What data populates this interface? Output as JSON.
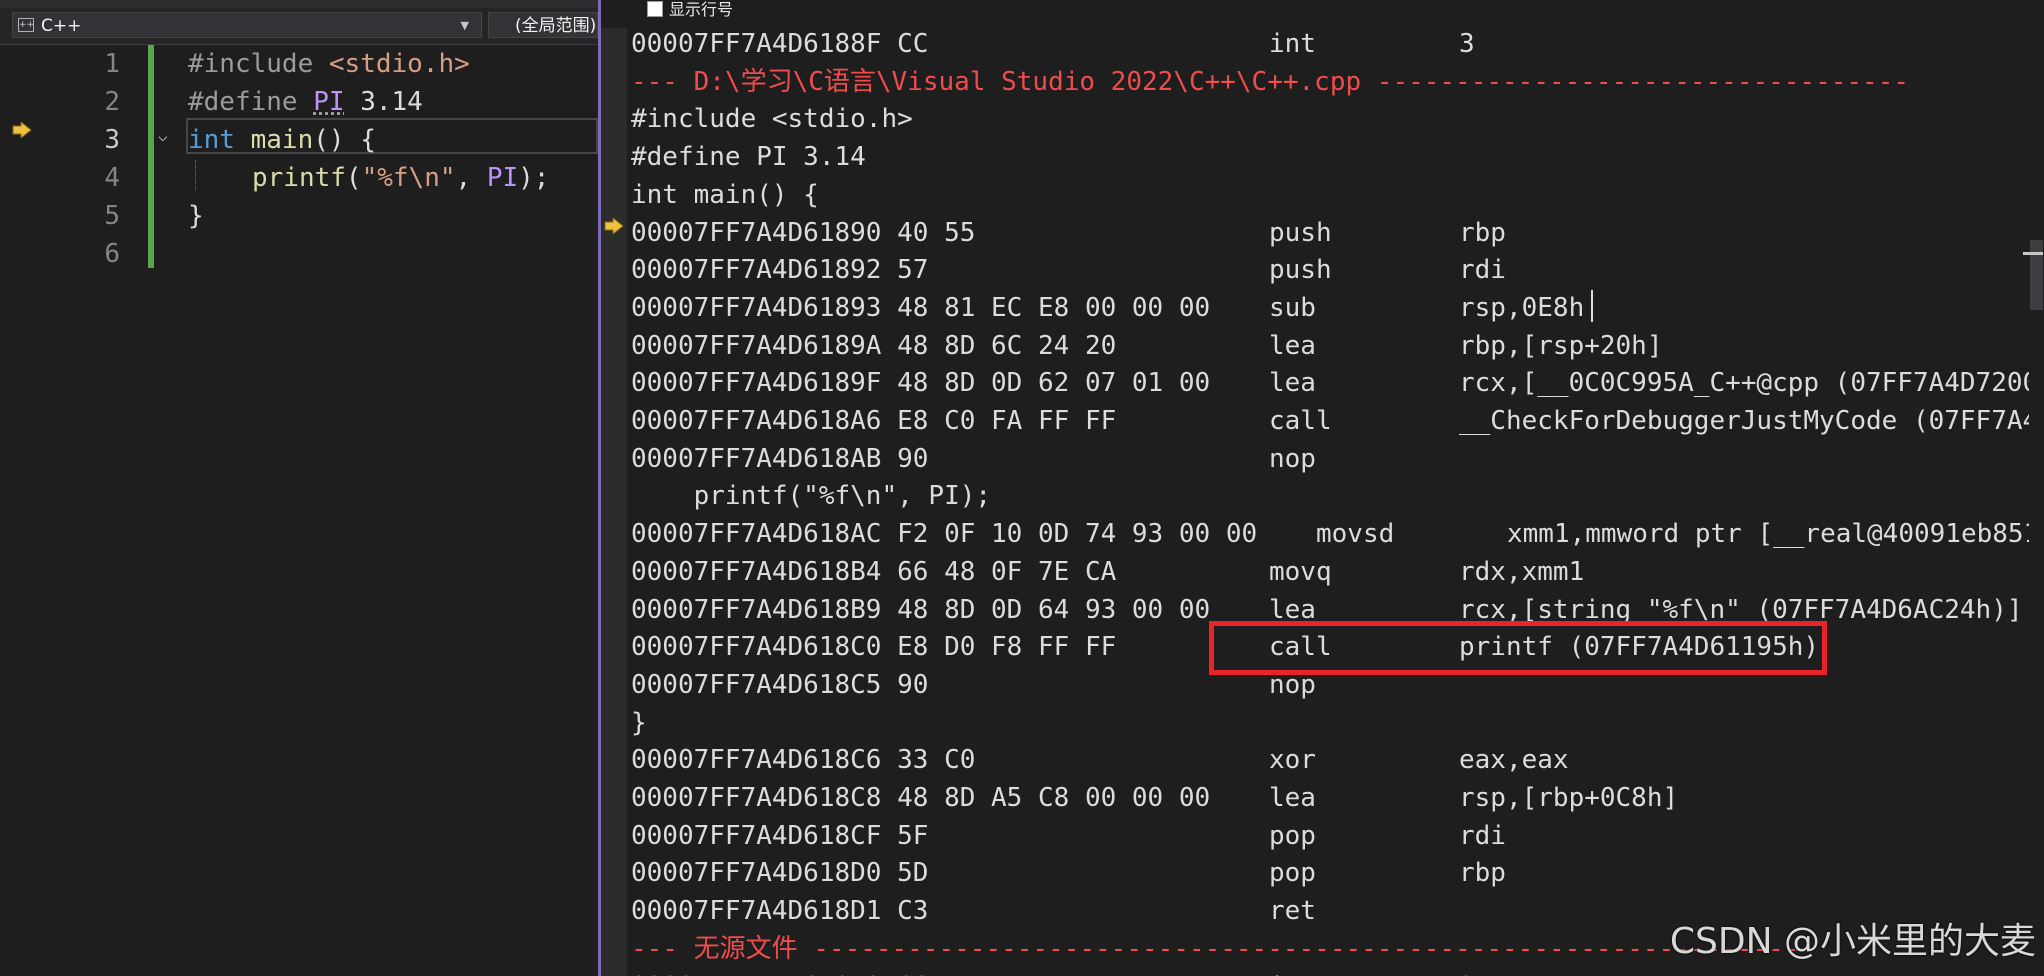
{
  "editor": {
    "project_combo": "C++",
    "scope_combo": "(全局范围)",
    "lines": [
      {
        "num": "1"
      },
      {
        "num": "2"
      },
      {
        "num": "3"
      },
      {
        "num": "4"
      },
      {
        "num": "5"
      },
      {
        "num": "6"
      }
    ],
    "code": {
      "l1_directive": "#include ",
      "l1_header": "<stdio.h>",
      "l2_directive": "#define ",
      "l2_macro": "PI",
      "l2_value": " 3.14",
      "l3_kw": "int",
      "l3_fn": " main",
      "l3_rest": "() {",
      "l4_fn": "printf",
      "l4_open": "(",
      "l4_str": "\"%f\\n\"",
      "l4_comma": ", ",
      "l4_macro": "PI",
      "l4_close": ");",
      "l5": "}"
    }
  },
  "disassembly": {
    "show_line_numbers_label": "显示行号",
    "rows": [
      {
        "kind": "asm",
        "addr": "00007FF7A4D6188F CC",
        "mn": "int",
        "op": "3"
      },
      {
        "kind": "header",
        "text": "--- D:\\学习\\C语言\\Visual Studio 2022\\C++\\C++.cpp ----------------------------------"
      },
      {
        "kind": "src",
        "text": "#include <stdio.h>"
      },
      {
        "kind": "src",
        "text": "#define PI 3.14"
      },
      {
        "kind": "src",
        "text": "int main() {"
      },
      {
        "kind": "asm",
        "addr": "00007FF7A4D61890 40 55",
        "mn": "push",
        "op": "rbp"
      },
      {
        "kind": "asm",
        "addr": "00007FF7A4D61892 57",
        "mn": "push",
        "op": "rdi"
      },
      {
        "kind": "asm",
        "addr": "00007FF7A4D61893 48 81 EC E8 00 00 00",
        "mn": "sub",
        "op": "rsp,0E8h"
      },
      {
        "kind": "asm",
        "addr": "00007FF7A4D6189A 48 8D 6C 24 20",
        "mn": "lea",
        "op": "rbp,[rsp+20h]"
      },
      {
        "kind": "asm",
        "addr": "00007FF7A4D6189F 48 8D 0D 62 07 01 00",
        "mn": "lea",
        "op": "rcx,[__0C0C995A_C++@cpp (07FF7A4D7200"
      },
      {
        "kind": "asm",
        "addr": "00007FF7A4D618A6 E8 C0 FA FF FF",
        "mn": "call",
        "op": "__CheckForDebuggerJustMyCode (07FF7A4"
      },
      {
        "kind": "asm",
        "addr": "00007FF7A4D618AB 90",
        "mn": "nop",
        "op": ""
      },
      {
        "kind": "src",
        "text": "    printf(\"%f\\n\", PI);"
      },
      {
        "kind": "asm_wide",
        "addr": "00007FF7A4D618AC F2 0F 10 0D 74 93 00 00",
        "mn": "movsd",
        "op": "xmm1,mmword ptr [__real@40091eb851"
      },
      {
        "kind": "asm",
        "addr": "00007FF7A4D618B4 66 48 0F 7E CA",
        "mn": "movq",
        "op": "rdx,xmm1"
      },
      {
        "kind": "asm",
        "addr": "00007FF7A4D618B9 48 8D 0D 64 93 00 00",
        "mn": "lea",
        "op": "rcx,[string \"%f\\n\" (07FF7A4D6AC24h)]"
      },
      {
        "kind": "asm",
        "addr": "00007FF7A4D618C0 E8 D0 F8 FF FF",
        "mn": "call",
        "op": "printf (07FF7A4D61195h)"
      },
      {
        "kind": "asm",
        "addr": "00007FF7A4D618C5 90",
        "mn": "nop",
        "op": ""
      },
      {
        "kind": "src",
        "text": "}"
      },
      {
        "kind": "asm",
        "addr": "00007FF7A4D618C6 33 C0",
        "mn": "xor",
        "op": "eax,eax"
      },
      {
        "kind": "asm",
        "addr": "00007FF7A4D618C8 48 8D A5 C8 00 00 00",
        "mn": "lea",
        "op": "rsp,[rbp+0C8h]"
      },
      {
        "kind": "asm",
        "addr": "00007FF7A4D618CF 5F",
        "mn": "pop",
        "op": "rdi"
      },
      {
        "kind": "asm",
        "addr": "00007FF7A4D618D0 5D",
        "mn": "pop",
        "op": "rbp"
      },
      {
        "kind": "asm",
        "addr": "00007FF7A4D618D1 C3",
        "mn": "ret",
        "op": ""
      },
      {
        "kind": "header",
        "text": "--- 无源文件 ---------------------------------------------------------------"
      },
      {
        "kind": "asm",
        "addr": "00007FF7A4D618D2 CC",
        "mn": "int",
        "op": "3"
      }
    ]
  },
  "watermark": "CSDN @小米里的大麦",
  "colors": {
    "highlight_box": "#e8232a",
    "source_header": "#f14c4c",
    "change_bar": "#57a64a"
  }
}
